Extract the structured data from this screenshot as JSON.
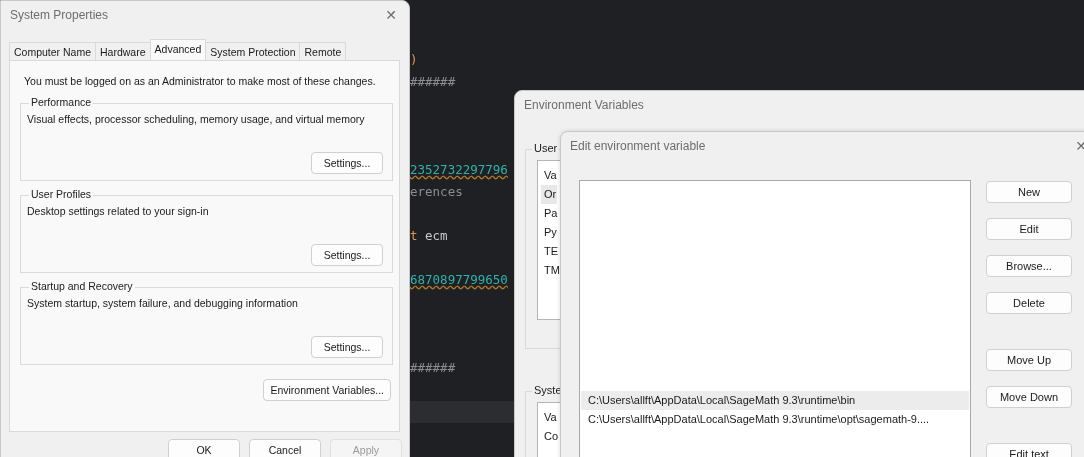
{
  "editor": {
    "lines": [
      {
        "kind": "code",
        "current": false,
        "tokens": [
          {
            "kind": "keyword",
            "text": ")"
          }
        ]
      },
      {
        "kind": "code",
        "current": false,
        "tokens": [
          {
            "kind": "comment",
            "text": "######"
          }
        ]
      },
      {
        "kind": "blank",
        "current": false
      },
      {
        "kind": "blank",
        "current": false
      },
      {
        "kind": "blank",
        "current": false
      },
      {
        "kind": "code",
        "current": false,
        "tokens": [
          {
            "kind": "number",
            "text": "2352732297796"
          }
        ]
      },
      {
        "kind": "code",
        "current": false,
        "tokens": [
          {
            "kind": "comment",
            "text": "erences"
          }
        ]
      },
      {
        "kind": "blank",
        "current": false
      },
      {
        "kind": "code",
        "current": false,
        "tokens": [
          {
            "kind": "keyword",
            "text": "t"
          },
          {
            "kind": "plain",
            "text": " ecm"
          }
        ]
      },
      {
        "kind": "blank",
        "current": false
      },
      {
        "kind": "code",
        "current": false,
        "tokens": [
          {
            "kind": "number",
            "text": "6870897799650"
          }
        ]
      },
      {
        "kind": "blank",
        "current": false
      },
      {
        "kind": "blank",
        "current": false
      },
      {
        "kind": "blank",
        "current": false
      },
      {
        "kind": "code",
        "current": false,
        "tokens": [
          {
            "kind": "comment",
            "text": "######"
          }
        ]
      },
      {
        "kind": "blank",
        "current": false
      },
      {
        "kind": "blank",
        "current": true
      }
    ]
  },
  "system_properties": {
    "title": "System Properties",
    "close": "✕",
    "tabs": [
      {
        "label": "Computer Name",
        "selected": false
      },
      {
        "label": "Hardware",
        "selected": false
      },
      {
        "label": "Advanced",
        "selected": true
      },
      {
        "label": "System Protection",
        "selected": false
      },
      {
        "label": "Remote",
        "selected": false
      }
    ],
    "notice": "You must be logged on as an Administrator to make most of these changes.",
    "groups": [
      {
        "title": "Performance",
        "description": "Visual effects, processor scheduling, memory usage, and virtual memory",
        "button": "Settings..."
      },
      {
        "title": "User Profiles",
        "description": "Desktop settings related to your sign-in",
        "button": "Settings..."
      },
      {
        "title": "Startup and Recovery",
        "description": "System startup, system failure, and debugging information",
        "button": "Settings..."
      }
    ],
    "environment_button": "Environment Variables...",
    "buttons": [
      {
        "label": "OK",
        "disabled": false
      },
      {
        "label": "Cancel",
        "disabled": false
      },
      {
        "label": "Apply",
        "disabled": true
      }
    ]
  },
  "environment_variables": {
    "title": "Environment Variables",
    "user_group": {
      "title": "User",
      "header": "Va",
      "rows": [
        {
          "name": "Or",
          "selected": true
        },
        {
          "name": "Pa",
          "selected": false
        },
        {
          "name": "Py",
          "selected": false
        },
        {
          "name": "TE",
          "selected": false
        },
        {
          "name": "TM",
          "selected": false
        }
      ]
    },
    "system_group": {
      "title": "Syste",
      "header": "Va",
      "rows": [
        {
          "name": "Co",
          "selected": false
        }
      ]
    }
  },
  "edit_variable": {
    "title": "Edit environment variable",
    "close": "✕",
    "entries": [
      {
        "path": "C:\\Users\\allft\\AppData\\Local\\SageMath 9.3\\runtime\\bin",
        "selected": true
      },
      {
        "path": "C:\\Users\\allft\\AppData\\Local\\SageMath 9.3\\runtime\\opt\\sagemath-9....",
        "selected": false
      }
    ],
    "button_groups": [
      [
        "New",
        "Edit",
        "Browse...",
        "Delete"
      ],
      [
        "Move Up",
        "Move Down"
      ],
      [
        "Edit text"
      ]
    ]
  }
}
